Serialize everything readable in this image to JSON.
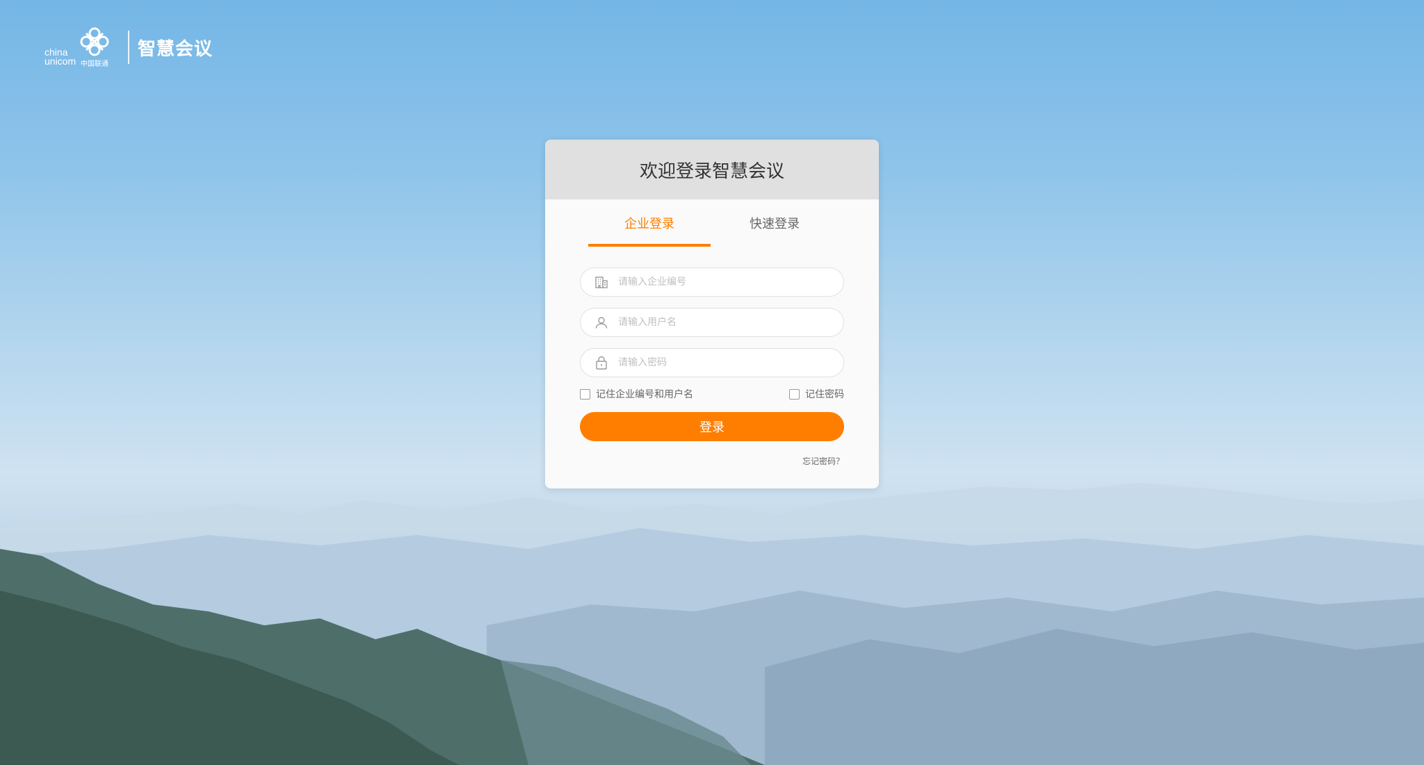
{
  "logo": {
    "en_line1": "china",
    "en_line2": "unicom",
    "cn_small": "中国联通",
    "title": "智慧会议"
  },
  "card": {
    "title": "欢迎登录智慧会议",
    "tabs": [
      {
        "label": "企业登录",
        "active": true
      },
      {
        "label": "快速登录",
        "active": false
      }
    ],
    "fields": {
      "company": {
        "placeholder": "请输入企业编号",
        "icon": "building-icon"
      },
      "username": {
        "placeholder": "请输入用户名",
        "icon": "user-icon"
      },
      "password": {
        "placeholder": "请输入密码",
        "icon": "lock-icon"
      }
    },
    "remember_company_user": "记住企业编号和用户名",
    "remember_password": "记住密码",
    "login_button": "登录",
    "forgot_password": "忘记密码？"
  },
  "colors": {
    "accent": "#ff7e00",
    "header_bg": "#e0e0e0",
    "card_bg": "#fafafa",
    "title_text": "#333333",
    "placeholder_text": "#c0c0c0",
    "secondary_text": "#666666"
  }
}
